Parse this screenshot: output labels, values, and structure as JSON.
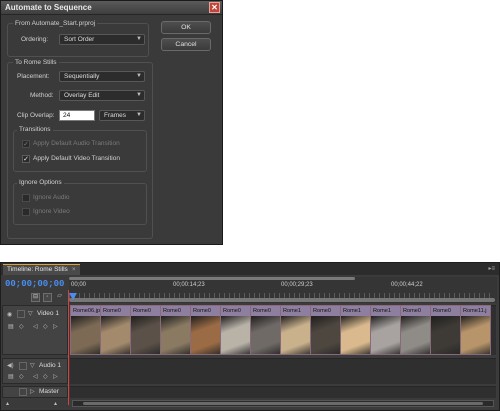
{
  "dialog": {
    "title": "Automate to Sequence",
    "from_label": "From Automate_Start.prproj",
    "ordering_label": "Ordering:",
    "ordering_value": "Sort Order",
    "ok_label": "OK",
    "cancel_label": "Cancel",
    "to_label": "To Rome Stills",
    "placement_label": "Placement:",
    "placement_value": "Sequentially",
    "method_label": "Method:",
    "method_value": "Overlay Edit",
    "clip_overlap_label": "Clip Overlap:",
    "clip_overlap_value": "24",
    "clip_overlap_unit": "Frames",
    "transitions_label": "Transitions",
    "audio_transition_label": "Apply Default Audio Transition",
    "audio_transition_checked": true,
    "audio_transition_enabled": false,
    "video_transition_label": "Apply Default Video Transition",
    "video_transition_checked": true,
    "ignore_label": "Ignore Options",
    "ignore_audio_label": "Ignore Audio",
    "ignore_video_label": "Ignore Video"
  },
  "timeline": {
    "tab_label": "Timeline: Rome Stills",
    "timecode": "00;00;00;00",
    "ruler_ticks": [
      "00;00",
      "00;00:14;23",
      "00;00;29;23",
      "00;00;44;22"
    ],
    "tracks": {
      "video1": "Video 1",
      "audio1": "Audio 1",
      "master": "Master"
    },
    "clips": [
      {
        "label": "Rome06.jp",
        "thumb": "#7d6a55"
      },
      {
        "label": "Rome0",
        "thumb": "#a38a6c"
      },
      {
        "label": "Rome0",
        "thumb": "#5b5148"
      },
      {
        "label": "Rome0",
        "thumb": "#8a7a62"
      },
      {
        "label": "Rome0",
        "thumb": "#9b6b45"
      },
      {
        "label": "Rome0",
        "thumb": "#b8b2a7"
      },
      {
        "label": "Rome0",
        "thumb": "#6f6a66"
      },
      {
        "label": "Rome1",
        "thumb": "#c9b18c"
      },
      {
        "label": "Rome0",
        "thumb": "#4e4740"
      },
      {
        "label": "Rome1",
        "thumb": "#d9b98d"
      },
      {
        "label": "Rome1",
        "thumb": "#a8a3a0"
      },
      {
        "label": "Rome0",
        "thumb": "#8f8b86"
      },
      {
        "label": "Rome0",
        "thumb": "#3e3a35"
      },
      {
        "label": "Rome11.j",
        "thumb": "#b7946a"
      }
    ]
  }
}
